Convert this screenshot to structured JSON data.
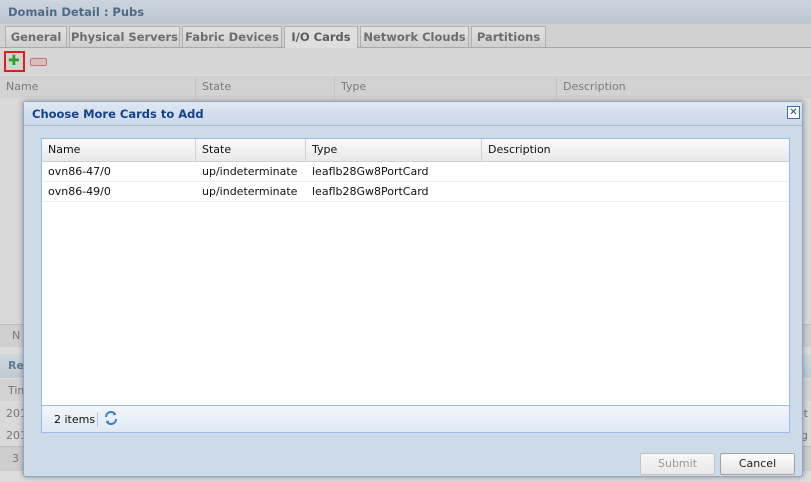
{
  "page": {
    "title": "Domain Detail : Pubs",
    "tabs": [
      {
        "label": "General"
      },
      {
        "label": "Physical Servers"
      },
      {
        "label": "Fabric Devices"
      },
      {
        "label": "I/O Cards"
      },
      {
        "label": "Network Clouds"
      },
      {
        "label": "Partitions"
      }
    ],
    "active_tab": "I/O Cards",
    "table": {
      "columns": [
        "Name",
        "State",
        "Type",
        "Description"
      ],
      "footer_partial": "N"
    },
    "section2": {
      "title_partial": "Re",
      "column_partial": "Tim",
      "rows": [
        {
          "left": "201",
          "right": "t"
        },
        {
          "left": "201",
          "right": "g"
        }
      ],
      "pager_partial": "3"
    }
  },
  "dialog": {
    "title": "Choose More Cards to Add",
    "close_icon": "close-icon",
    "columns": [
      "Name",
      "State",
      "Type",
      "Description"
    ],
    "rows": [
      {
        "name": "ovn86-47/0",
        "state": "up/indeterminate",
        "type": "leaflb28Gw8PortCard",
        "description": ""
      },
      {
        "name": "ovn86-49/0",
        "state": "up/indeterminate",
        "type": "leaflb28Gw8PortCard",
        "description": ""
      }
    ],
    "item_count": "2 items",
    "refresh_icon": "refresh-icon",
    "buttons": {
      "submit": "Submit",
      "cancel": "Cancel"
    }
  },
  "colors": {
    "dialog_title": "#15428b",
    "add_highlight": "#e01c1c",
    "add_icon": "#2e9d2e"
  }
}
